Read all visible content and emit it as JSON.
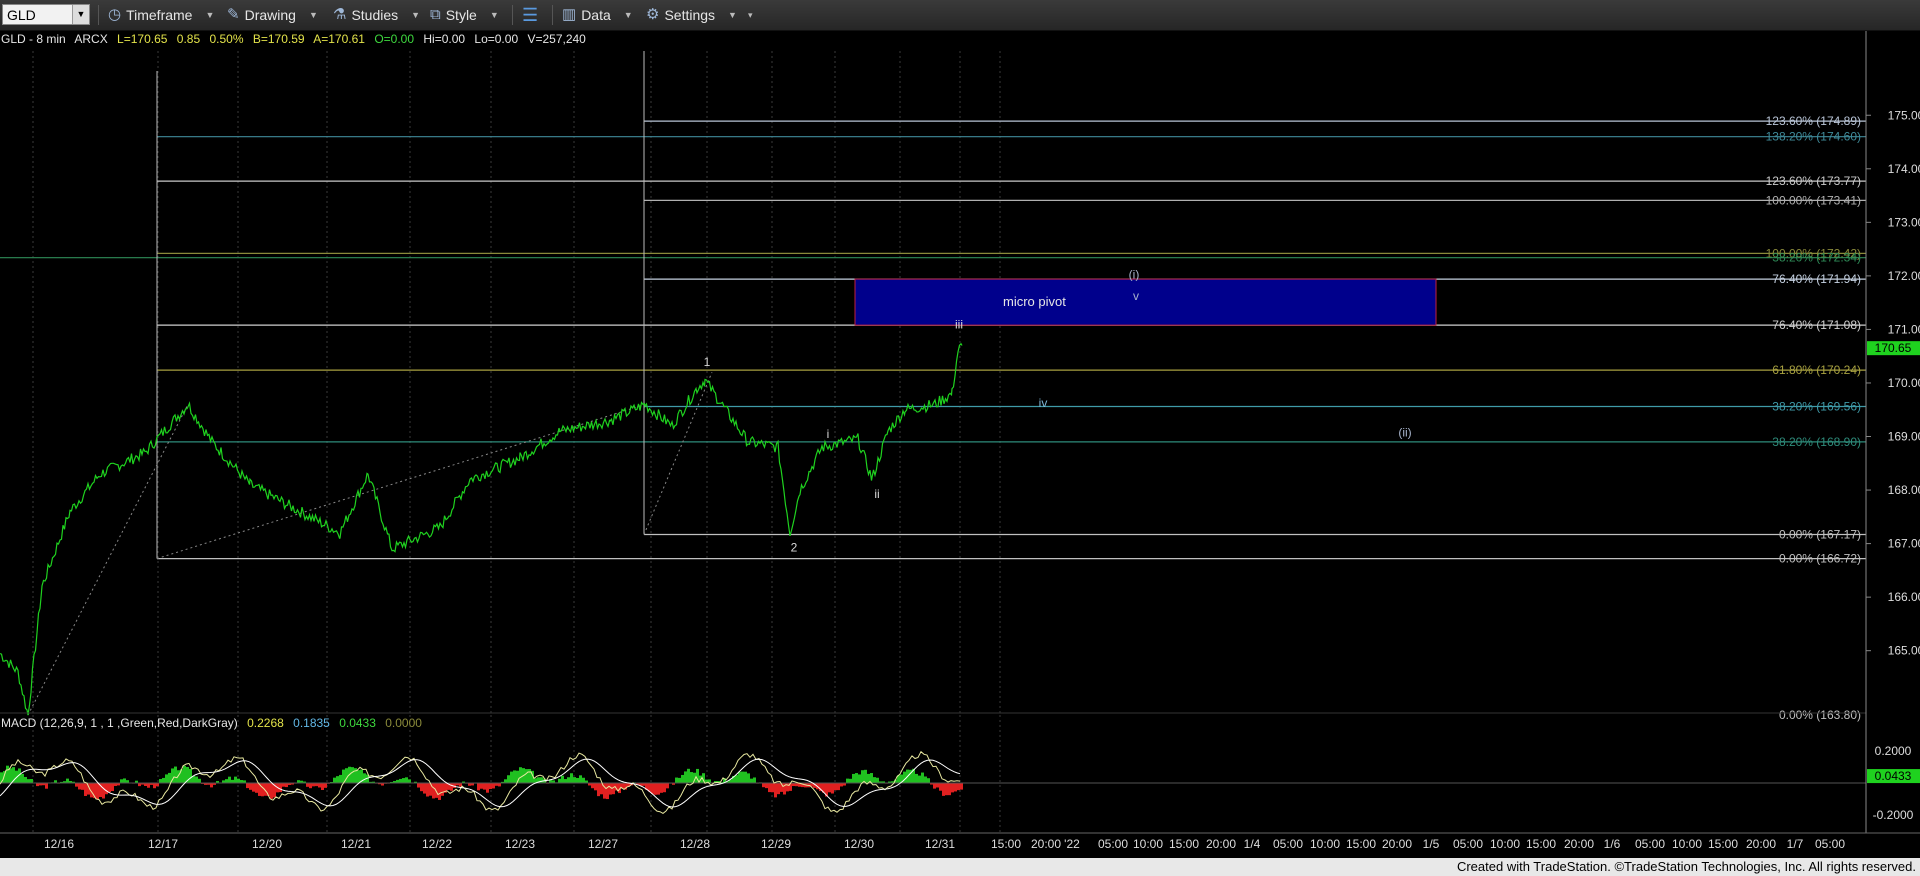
{
  "toolbar": {
    "symbol": "GLD",
    "timeframe": "Timeframe",
    "drawing": "Drawing",
    "studies": "Studies",
    "style": "Style",
    "data": "Data",
    "settings": "Settings"
  },
  "header": {
    "symbol_interval": "GLD - 8 min",
    "exchange": "ARCX",
    "last": "L=170.65",
    "change": "0.85",
    "pct": "0.50%",
    "bid": "B=170.59",
    "ask": "A=170.61",
    "open": "O=0.00",
    "hi": "Hi=0.00",
    "lo": "Lo=0.00",
    "volume": "V=257,240"
  },
  "macd": {
    "label": "MACD (12,26,9, 1 , 1 ,Green,Red,DarkGray)",
    "v1": "0.2268",
    "v2": "0.1835",
    "v3": "0.0433",
    "v4": "0.0000",
    "axis_labels": [
      "0.2000",
      "0.0433",
      "-0.2000"
    ],
    "axis_values": [
      0.2,
      0.0433,
      -0.2
    ],
    "current": 0.0433,
    "range": [
      -0.3,
      0.3
    ]
  },
  "price_axis": {
    "labels": [
      "175.00",
      "174.00",
      "173.00",
      "172.00",
      "171.00",
      "170.00",
      "169.00",
      "168.00",
      "167.00",
      "166.00",
      "165.00"
    ],
    "current_label": "170.65",
    "current": 170.65,
    "range": [
      163.5,
      176.2
    ]
  },
  "fib_levels": [
    {
      "text": "123.60% (174.89)",
      "price": 174.89,
      "start": "12/27",
      "color": "#b8c4d6"
    },
    {
      "text": "138.20% (174.60)",
      "price": 174.6,
      "start": "12/17",
      "color": "#3f8a99"
    },
    {
      "text": "123.60% (173.77)",
      "price": 173.77,
      "start": "12/17",
      "color": "#c9c9c9"
    },
    {
      "text": "100.00% (173.41)",
      "price": 173.41,
      "start": "12/27",
      "color": "#b0b0b0"
    },
    {
      "text": "100.00% (172.42)",
      "price": 172.42,
      "start": "12/17",
      "color": "#8a8a3a"
    },
    {
      "text": "38.20% (172.34)",
      "price": 172.34,
      "start": "0",
      "color": "#2e8b57"
    },
    {
      "text": "76.40% (171.94)",
      "price": 171.94,
      "start": "12/27",
      "color": "#c4d0e0"
    },
    {
      "text": "76.40% (171.08)",
      "price": 171.08,
      "start": "12/17",
      "color": "#d0d0d0"
    },
    {
      "text": "61.80% (170.24)",
      "price": 170.24,
      "start": "12/17",
      "color": "#a7a040"
    },
    {
      "text": "38.20% (169.56)",
      "price": 169.56,
      "start": "12/27",
      "color": "#3f9aa8"
    },
    {
      "text": "38.20% (168.90)",
      "price": 168.9,
      "start": "12/17",
      "color": "#2e8b7a"
    },
    {
      "text": "0.00% (167.17)",
      "price": 167.17,
      "start": "12/27",
      "color": "#c0c0c0"
    },
    {
      "text": "0.00% (166.72)",
      "price": 166.72,
      "start": "12/17",
      "color": "#c0c0c0"
    },
    {
      "text": "0.00% (163.80)",
      "price": 163.8,
      "start": "none",
      "color": "#c0c0c0"
    }
  ],
  "pivot_box": {
    "label": "micro pivot",
    "price_low": 171.08,
    "price_high": 171.94,
    "from": "12/30",
    "to": "1/4"
  },
  "wave_labels": [
    {
      "text": "1",
      "date": "12/28",
      "price": 170.32,
      "color": "#d8d8d8"
    },
    {
      "text": "2",
      "date": "12/29",
      "price": 166.85,
      "color": "#d8d8d8"
    },
    {
      "text": "i",
      "date": "12/30",
      "price": 168.97,
      "color": "#d8d8d8"
    },
    {
      "text": "ii",
      "date": "12/30",
      "price": 167.85,
      "color": "#d8d8d8"
    },
    {
      "text": "iii",
      "date": "12/31",
      "price": 171.02,
      "color": "#d8d8d8"
    },
    {
      "text": "iv",
      "date": "12/31",
      "price": 169.55,
      "color": "#7fb8d8"
    },
    {
      "text": "v",
      "date": "1/3",
      "price": 171.55,
      "color": "#a8b4cc"
    },
    {
      "text": "(i)",
      "date": "1/3",
      "price": 171.95,
      "color": "#a8b4cc"
    },
    {
      "text": "(ii)",
      "date": "1/4",
      "price": 169.0,
      "color": "#a8b4cc"
    }
  ],
  "x_axis": {
    "labels": [
      "12/16",
      "12/17",
      "12/20",
      "12/21",
      "12/22",
      "12/23",
      "12/27",
      "12/28",
      "12/29",
      "12/30",
      "12/31",
      "15:00",
      "20:00",
      "'22",
      "05:00",
      "10:00",
      "15:00",
      "20:00",
      "1/4",
      "05:00",
      "10:00",
      "15:00",
      "20:00",
      "1/5",
      "05:00",
      "10:00",
      "15:00",
      "20:00",
      "1/6",
      "05:00",
      "10:00",
      "15:00",
      "20:00",
      "1/7",
      "05:00"
    ]
  },
  "footer": {
    "text": "Created with TradeStation. ©TradeStation Technologies, Inc. All rights reserved."
  },
  "colors": {
    "price_line": "#1fd21f",
    "macd_up": "#20c020",
    "macd_down": "#e02020",
    "pivot_fill": "#00008c",
    "pivot_border": "#c02040"
  }
}
